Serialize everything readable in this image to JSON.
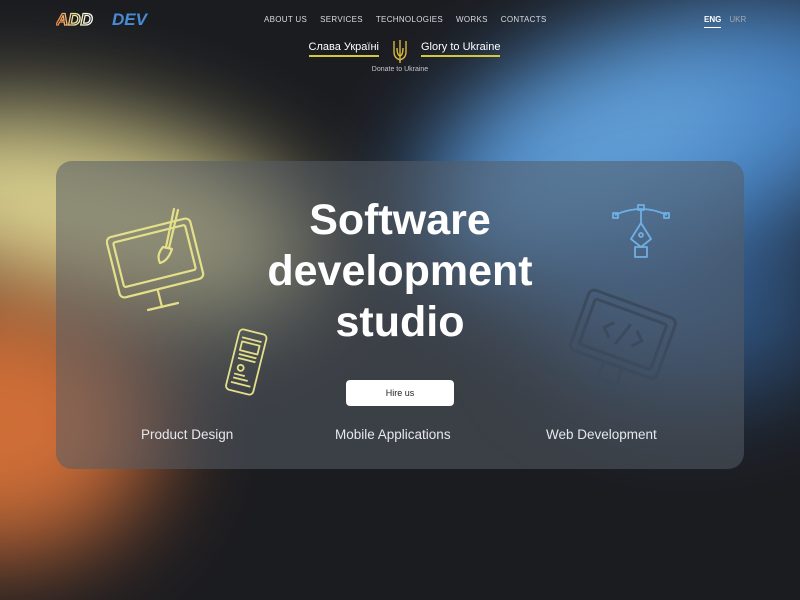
{
  "header": {
    "logo_text": "ADDDEV",
    "nav": [
      {
        "label": "ABOUT US"
      },
      {
        "label": "SERVICES"
      },
      {
        "label": "TECHNOLOGIES"
      },
      {
        "label": "WORKS"
      },
      {
        "label": "CONTACTS"
      }
    ],
    "lang": {
      "eng": "ENG",
      "ukr": "UKR",
      "selected": "ENG"
    }
  },
  "ukraine": {
    "left": "Слава Україні",
    "right": "Glory to Ukraine",
    "donate": "Donate to Ukraine",
    "icon": "trident-icon"
  },
  "hero": {
    "title_line1": "Software",
    "title_line2": "development",
    "title_line3": "studio",
    "button": "Hire us",
    "services": [
      "Product Design",
      "Mobile Applications",
      "Web Development"
    ],
    "icons": [
      "monitor-brush-icon",
      "phone-icon",
      "pen-tool-icon",
      "code-monitor-icon"
    ]
  },
  "colors": {
    "background": "#1b1c20",
    "ukraine_underline": "#d6c63a",
    "yellow_glow": "#efe49a",
    "orange_glow": "#ef7d3c",
    "blue_glow": "#4d8fd6",
    "icon_yellow": "#e4e08a",
    "icon_blue": "#6fb0e4"
  }
}
